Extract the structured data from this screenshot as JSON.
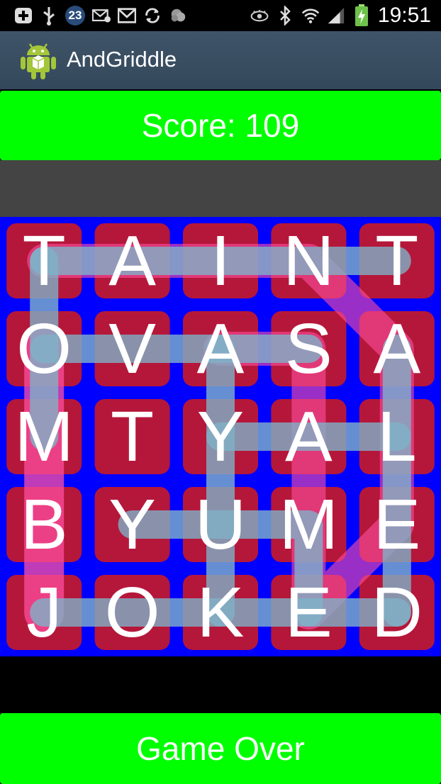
{
  "status_bar": {
    "notification_count": "23",
    "time": "19:51",
    "left_icons": [
      "plus-box-icon",
      "usb-icon",
      "notification-count-badge",
      "email-icon",
      "gmail-icon",
      "sync-icon",
      "weather-icon"
    ],
    "right_icons": [
      "eye-icon",
      "bluetooth-icon",
      "wifi-icon",
      "signal-icon",
      "battery-charging-icon"
    ]
  },
  "action_bar": {
    "app_name": "AndGriddle",
    "icon": "android-icon"
  },
  "score": {
    "label": "Score: 109"
  },
  "board": {
    "rows": [
      [
        "T",
        "A",
        "I",
        "N",
        "T"
      ],
      [
        "O",
        "V",
        "A",
        "S",
        "A"
      ],
      [
        "M",
        "T",
        "Y",
        "A",
        "L"
      ],
      [
        "B",
        "Y",
        "U",
        "M",
        "E"
      ],
      [
        "J",
        "O",
        "K",
        "E",
        "D"
      ]
    ],
    "colors": {
      "background": "#0000ff",
      "tile": "#b5173a",
      "path_light": "#7fb2c8",
      "path_pink": "#ff4fa0"
    }
  },
  "footer": {
    "button_label": "Game Over"
  },
  "colors": {
    "accent_green": "#00ff00",
    "actionbar": "#3b4e62"
  }
}
